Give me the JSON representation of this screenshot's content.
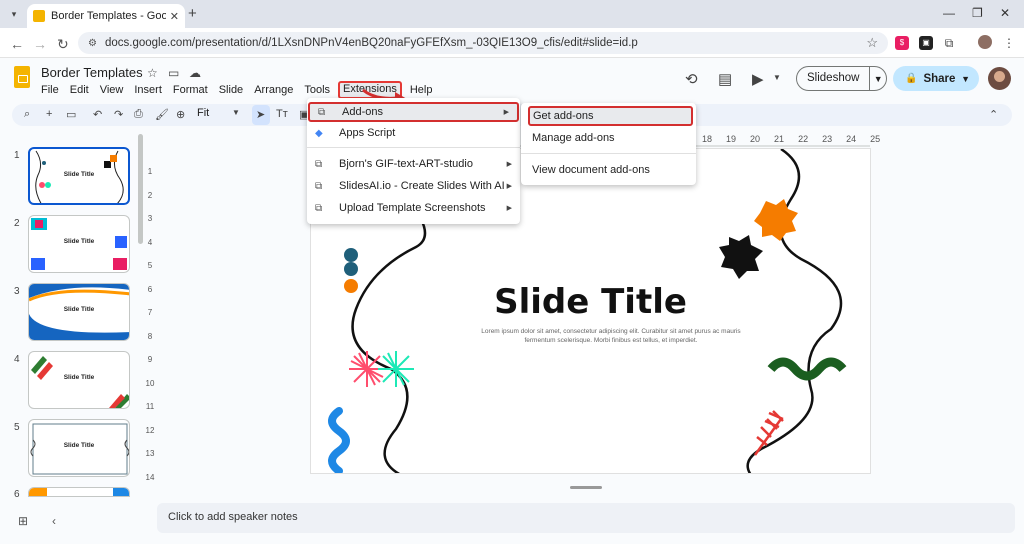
{
  "browser": {
    "tab_title": "Border Templates - Google Slides",
    "tab_close": "✕",
    "new_tab": "+",
    "url": "docs.google.com/presentation/d/1LXsnDNPnV4enBQ20naFyGFEfXsm_-03QIE13O9_cfis/edit#slide=id.p",
    "ext_label": "$"
  },
  "app": {
    "title": "Border Templates",
    "menus": [
      "File",
      "Edit",
      "View",
      "Insert",
      "Format",
      "Slide",
      "Arrange",
      "Tools",
      "Extensions",
      "Help"
    ],
    "slideshow_label": "Slideshow",
    "share_label": "Share"
  },
  "toolbar": {
    "zoom": "Fit"
  },
  "thumbnails": [
    {
      "num": "1",
      "title": "Slide Title"
    },
    {
      "num": "2",
      "title": "Slide Title"
    },
    {
      "num": "3",
      "title": "Slide Title"
    },
    {
      "num": "4",
      "title": "Slide Title"
    },
    {
      "num": "5",
      "title": "Slide Title"
    },
    {
      "num": "6",
      "title": ""
    }
  ],
  "ruler": {
    "top_ticks": [
      "18",
      "19",
      "20",
      "21",
      "22",
      "23",
      "24",
      "25"
    ],
    "left_ticks": [
      "1",
      "2",
      "3",
      "4",
      "5",
      "6",
      "7",
      "8",
      "9",
      "10",
      "11",
      "12",
      "13",
      "14"
    ]
  },
  "slide": {
    "title": "Slide Title",
    "subtitle": "Lorem ipsum dolor sit amet, consectetur adipiscing elit. Curabitur sit amet purus ac mauris fermentum scelerisque. Morbi finibus est tellus, et imperdiet."
  },
  "extensions_menu": {
    "items": [
      {
        "label": "Add-ons",
        "has_submenu": true
      },
      {
        "label": "Apps Script",
        "has_submenu": false
      },
      {
        "label": "Bjorn's GIF-text-ART-studio",
        "has_submenu": true
      },
      {
        "label": "SlidesAI.io - Create Slides With AI",
        "has_submenu": true
      },
      {
        "label": "Upload Template Screenshots",
        "has_submenu": true
      }
    ]
  },
  "addons_submenu": {
    "items": [
      "Get add-ons",
      "Manage add-ons",
      "View document add-ons"
    ]
  },
  "notes": {
    "placeholder": "Click to add speaker notes"
  },
  "colors": {
    "accent_blue": "#0b57d0",
    "highlight_red": "#d32f2f",
    "share_bg": "#c2e7ff"
  }
}
